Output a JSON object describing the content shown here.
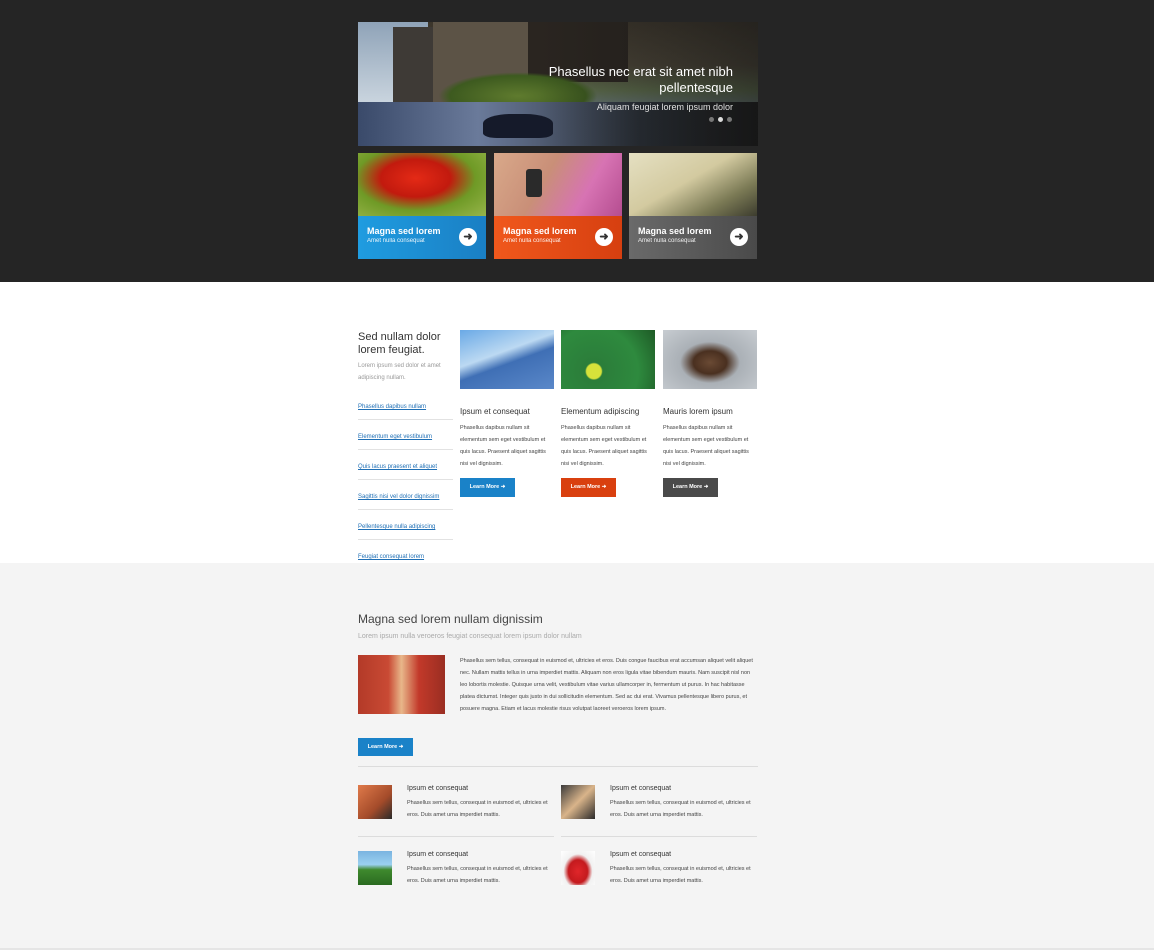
{
  "slider": {
    "title": "Phasellus nec erat sit amet nibh pellentesque",
    "subtitle": "Aliquam feugiat lorem ipsum dolor"
  },
  "features": [
    {
      "title": "Magna sed lorem",
      "subtitle": "Amet nulla consequat",
      "color": "#1f9ce0"
    },
    {
      "title": "Magna sed lorem",
      "subtitle": "Amet nulla consequat",
      "color": "#f0581c"
    },
    {
      "title": "Magna sed lorem",
      "subtitle": "Amet nulla consequat",
      "color": "#555555"
    }
  ],
  "sidebar": {
    "heading": "Sed nullam dolor lorem feugiat.",
    "text": "Lorem ipsum sed dolor et amet adipiscing nullam.",
    "links": [
      "Phasellus dapibus nullam",
      "Elementum eget vestibulum",
      "Quis lacus praesent et aliquet",
      "Sagittis nisi vel dolor dignissim",
      "Pellentesque nulla adipiscing",
      "Feugiat consequat lorem"
    ]
  },
  "cards": [
    {
      "title": "Ipsum et consequat",
      "text": "Phasellus dapibus nullam sit elementum sem eget vestibulum et quis lacus. Praesent aliquet sagittis nisi vel dignissim.",
      "button": "Learn More",
      "color": "#1a82c8"
    },
    {
      "title": "Elementum adipiscing",
      "text": "Phasellus dapibus nullam sit elementum sem eget vestibulum et quis lacus. Praesent aliquet sagittis nisi vel dignissim.",
      "button": "Learn More",
      "color": "#d9400f"
    },
    {
      "title": "Mauris lorem ipsum",
      "text": "Phasellus dapibus nullam sit elementum sem eget vestibulum et quis lacus. Praesent aliquet sagittis nisi vel dignissim.",
      "button": "Learn More",
      "color": "#4a4a4a"
    }
  ],
  "section": {
    "title": "Magna sed lorem nullam dignissim",
    "subtitle": "Lorem ipsum nulla veroeros feugiat consequat lorem ipsum dolor nullam",
    "text": "Phasellus sem tellus, consequat in euismod et, ultricies et eros. Duis congue faucibus erat accumsan aliquet velit aliquet nec. Nullam mattis tellus in urna imperdiet mattis. Aliquam non eros ligula vitae bibendum mauris. Nam suscipit nisl non leo lobortis molestie. Quisque urna velit, vestibulum vitae varius ullamcorper in, fermentum ut purus. In hac habitasse platea dictumst. Integer quis justo in dui sollicitudin elementum. Sed ac dui erat. Vivamus pellentesque libero purus, et posuere magna. Etiam et lacus molestie risus volutpat laoreet veroeros lorem ipsum.",
    "button": "Learn More"
  },
  "minis": [
    {
      "title": "Ipsum et consequat",
      "text": "Phasellus sem tellus, consequat in euismod et, ultricies et eros. Duis amet urna imperdiet mattis."
    },
    {
      "title": "Ipsum et consequat",
      "text": "Phasellus sem tellus, consequat in euismod et, ultricies et eros. Duis amet urna imperdiet mattis."
    },
    {
      "title": "Ipsum et consequat",
      "text": "Phasellus sem tellus, consequat in euismod et, ultricies et eros. Duis amet urna imperdiet mattis."
    },
    {
      "title": "Ipsum et consequat",
      "text": "Phasellus sem tellus, consequat in euismod et, ultricies et eros. Duis amet urna imperdiet mattis."
    }
  ]
}
